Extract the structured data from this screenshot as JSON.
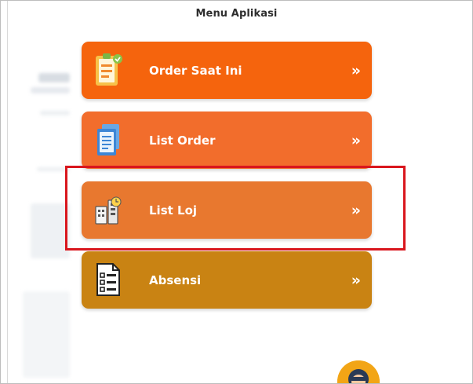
{
  "header": {
    "title": "Menu Aplikasi"
  },
  "menu": {
    "items": [
      {
        "label": "Order Saat Ini",
        "chevron": "»",
        "icon": "clipboard-icon",
        "color": "#f5640d"
      },
      {
        "label": "List Order",
        "chevron": "»",
        "icon": "document-list-icon",
        "color": "#f26d2c"
      },
      {
        "label": "List Loj",
        "chevron": "»",
        "icon": "building-icon",
        "color": "#e8782f"
      },
      {
        "label": "Absensi",
        "chevron": "»",
        "icon": "attendance-form-icon",
        "color": "#c98313"
      }
    ]
  },
  "highlight": {
    "color": "#d9161d",
    "target": "List Loj"
  },
  "avatar": {
    "icon": "user-avatar-icon",
    "color": "#f2a516"
  }
}
